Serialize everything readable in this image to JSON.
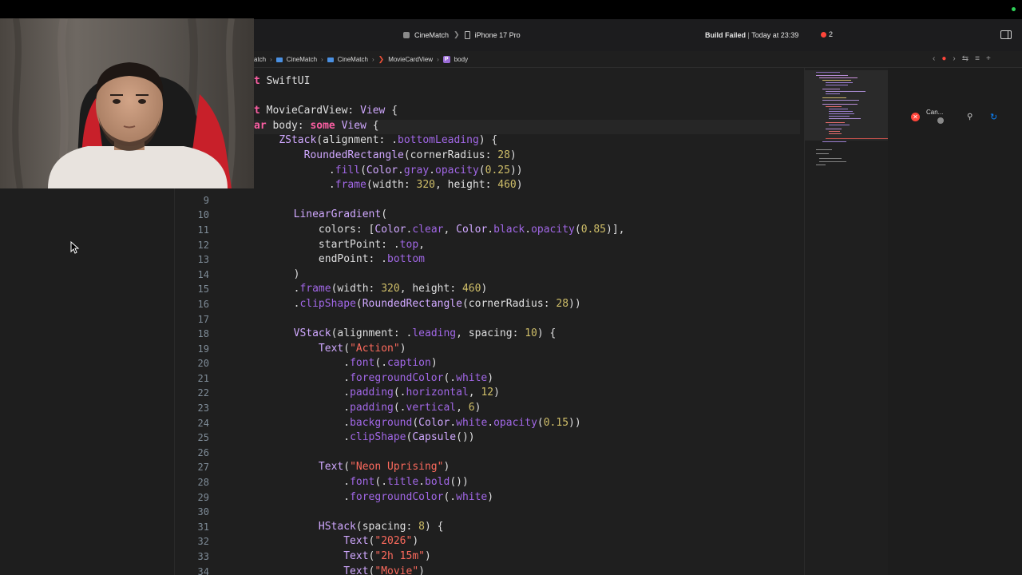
{
  "toolbar": {
    "scheme": "CineMatch",
    "device": "iPhone 17 Pro",
    "build_status": "Build Failed",
    "build_time": "Today at 23:39",
    "issue_count": "2"
  },
  "jumpbar": {
    "crumbs": [
      "atch",
      "CineMatch",
      "CineMatch",
      "MovieCardView",
      "body"
    ]
  },
  "right_panel": {
    "label": "Can..."
  },
  "editor": {
    "lines": [
      {
        "num": "",
        "html": "<span class=\"kw\">t</span> SwiftUI"
      },
      {
        "num": "",
        "html": ""
      },
      {
        "num": "",
        "html": "<span class=\"kw\">t</span> MovieCardView: <span class=\"ty\">View</span> {"
      },
      {
        "num": "",
        "html": "<span class=\"kw\">ar</span> body: <span class=\"kw\">some</span> <span class=\"ty\">View</span> {"
      },
      {
        "num": "",
        "html": "    <span class=\"ty\">ZStack</span>(alignment: .<span class=\"mb\">bottomLeading</span>) {"
      },
      {
        "num": "",
        "html": "        <span class=\"ty\">RoundedRectangle</span>(cornerRadius: <span class=\"nu\">28</span>)"
      },
      {
        "num": "",
        "html": "            .<span class=\"mb\">fill</span>(<span class=\"ty\">Color</span>.<span class=\"mb\">gray</span>.<span class=\"mb\">opacity</span>(<span class=\"nu\">0.25</span>))"
      },
      {
        "num": "",
        "html": "            .<span class=\"mb\">frame</span>(width: <span class=\"nu\">320</span>, height: <span class=\"nu\">460</span>)"
      },
      {
        "num": "9",
        "html": ""
      },
      {
        "num": "10",
        "html": "        <span class=\"ty\">LinearGradient</span>("
      },
      {
        "num": "11",
        "html": "            colors: [<span class=\"ty\">Color</span>.<span class=\"mb\">clear</span>, <span class=\"ty\">Color</span>.<span class=\"mb\">black</span>.<span class=\"mb\">opacity</span>(<span class=\"nu\">0.85</span>)],"
      },
      {
        "num": "12",
        "html": "            startPoint: .<span class=\"mb\">top</span>,"
      },
      {
        "num": "13",
        "html": "            endPoint: .<span class=\"mb\">bottom</span>"
      },
      {
        "num": "14",
        "html": "        )"
      },
      {
        "num": "15",
        "html": "        .<span class=\"mb\">frame</span>(width: <span class=\"nu\">320</span>, height: <span class=\"nu\">460</span>)"
      },
      {
        "num": "16",
        "html": "        .<span class=\"mb\">clipShape</span>(<span class=\"ty\">RoundedRectangle</span>(cornerRadius: <span class=\"nu\">28</span>))"
      },
      {
        "num": "17",
        "html": ""
      },
      {
        "num": "18",
        "html": "        <span class=\"ty\">VStack</span>(alignment: .<span class=\"mb\">leading</span>, spacing: <span class=\"nu\">10</span>) {"
      },
      {
        "num": "19",
        "html": "            <span class=\"ty\">Text</span>(<span class=\"st\">\"Action\"</span>)"
      },
      {
        "num": "20",
        "html": "                .<span class=\"mb\">font</span>(.<span class=\"mb\">caption</span>)"
      },
      {
        "num": "21",
        "html": "                .<span class=\"mb\">foregroundColor</span>(.<span class=\"mb\">white</span>)"
      },
      {
        "num": "22",
        "html": "                .<span class=\"mb\">padding</span>(.<span class=\"mb\">horizontal</span>, <span class=\"nu\">12</span>)"
      },
      {
        "num": "23",
        "html": "                .<span class=\"mb\">padding</span>(.<span class=\"mb\">vertical</span>, <span class=\"nu\">6</span>)"
      },
      {
        "num": "24",
        "html": "                .<span class=\"mb\">background</span>(<span class=\"ty\">Color</span>.<span class=\"mb\">white</span>.<span class=\"mb\">opacity</span>(<span class=\"nu\">0.15</span>))"
      },
      {
        "num": "25",
        "html": "                .<span class=\"mb\">clipShape</span>(<span class=\"ty\">Capsule</span>())"
      },
      {
        "num": "26",
        "html": ""
      },
      {
        "num": "27",
        "html": "            <span class=\"ty\">Text</span>(<span class=\"st\">\"Neon Uprising\"</span>)"
      },
      {
        "num": "28",
        "html": "                .<span class=\"mb\">font</span>(.<span class=\"mb\">title</span>.<span class=\"mb\">bold</span>())"
      },
      {
        "num": "29",
        "html": "                .<span class=\"mb\">foregroundColor</span>(.<span class=\"mb\">white</span>)"
      },
      {
        "num": "30",
        "html": ""
      },
      {
        "num": "31",
        "html": "            <span class=\"ty\">HStack</span>(spacing: <span class=\"nu\">8</span>) {"
      },
      {
        "num": "32",
        "html": "                <span class=\"ty\">Text</span>(<span class=\"st\">\"2026\"</span>)"
      },
      {
        "num": "33",
        "html": "                <span class=\"ty\">Text</span>(<span class=\"st\">\"2h 15m\"</span>)"
      },
      {
        "num": "34",
        "html": "                <span class=\"ty\">Text</span>(<span class=\"st\">\"Movie\"</span>)"
      }
    ]
  },
  "colors": {
    "error": "#ff453a",
    "keyword": "#fc5fa3",
    "type": "#d0a8ff",
    "string": "#fc6a5d",
    "number": "#d0bf69"
  }
}
